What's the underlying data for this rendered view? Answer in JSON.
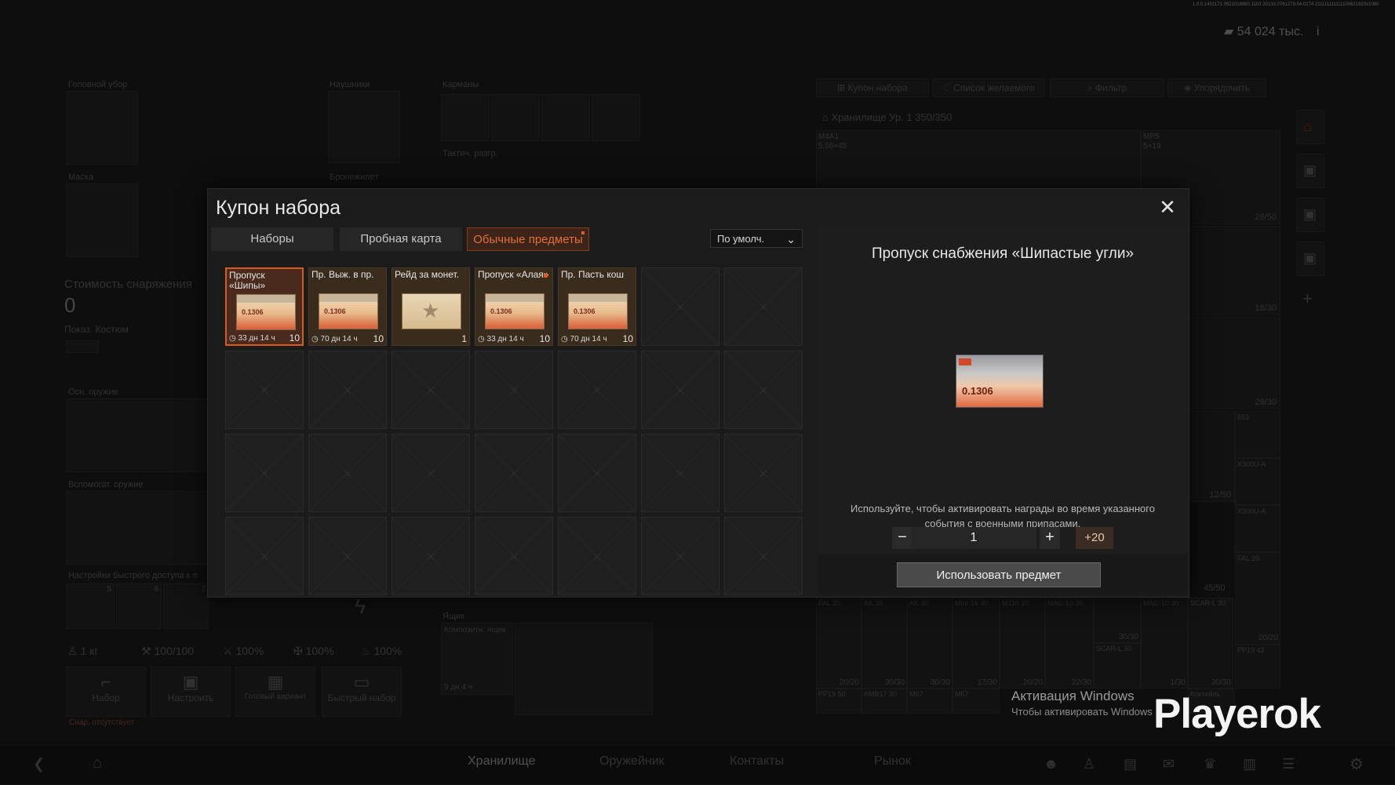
{
  "version_string": "1.0.0.1401171 0921018860.1103 20133.0761279.04.0274 211111111111100621920x1080",
  "currency": {
    "amount": "54 024 тыс.",
    "info": "i"
  },
  "background": {
    "labels": {
      "headgear": "Головной убор",
      "headphones": "Наушники",
      "pockets": "Карманы",
      "tactical_vest": "Тактич. разгр.",
      "mask": "Маска",
      "body_armor": "Бронежилет",
      "equipment_cost": "Стоимость снаряжения",
      "equipment_cost_value": "0",
      "show_costume": "Показ. Костюм",
      "primary_weapon": "Осн. оружие",
      "secondary_weapon": "Вспомогат. оружие",
      "quick_access": "Настройки быстрого доступа к п",
      "box": "Ящик",
      "composite_box": "Композитн. ящик",
      "box_timer": "9 дн 4 ч",
      "no_equipment": "Снар. отсутствует"
    },
    "stats": [
      "1 кг",
      "100/100",
      "100%",
      "100%",
      "100%"
    ],
    "quick_slots": [
      "5",
      "6",
      "7"
    ],
    "action_buttons": [
      "Набор",
      "Настроить",
      "Готовый вариант",
      "Быстрый набор"
    ],
    "right_panel": {
      "buttons": [
        "Купон набора",
        "Список желаемого",
        "Фильтр",
        "Упорядочить"
      ],
      "storage": "Хранилище Ур. 1 350/350",
      "weapons": [
        "M4A1",
        "5.56×45",
        "MP5",
        "5×19"
      ],
      "counts": [
        "26/50",
        "18/30",
        "29/30",
        "12/50",
        "45/50",
        "20/20",
        "30/30",
        "30/30",
        "17/30",
        "20/20",
        "22/30",
        "30/30",
        "1/30",
        "30/30",
        "20/20"
      ],
      "scopes": [
        "553",
        "X300U-A",
        "X300U-A",
        "FAL 20"
      ],
      "mags": [
        "FAL 20",
        "AK 30",
        "AK 30",
        "Mini-14 30",
        "M110 20",
        "MAC-10 30",
        "MAC-10 30",
        "SCAR-L 30",
        "SCAR-L 30",
        "PP19 42",
        "PP19 50",
        "AMB17 30",
        "M67",
        "M67",
        "Коктейль"
      ]
    }
  },
  "bottom_nav": {
    "tabs": [
      "Хранилище",
      "Оружейник",
      "Контакты",
      "Рынок"
    ],
    "active": 0
  },
  "modal": {
    "title": "Купон набора",
    "tabs": [
      "Наборы",
      "Пробная карта",
      "Обычные предметы"
    ],
    "active_tab": 2,
    "sort": "По умолч.",
    "items": [
      {
        "name": "Пропуск «Шипы»",
        "time": "33 дн 14 ч",
        "count": "10",
        "kind": "ticket",
        "selected": true,
        "dot": false
      },
      {
        "name": "Пр. Выж. в пр.",
        "time": "70 дн 14 ч",
        "count": "10",
        "kind": "ticket",
        "selected": false,
        "dot": false
      },
      {
        "name": "Рейд за монет.",
        "time": "",
        "count": "1",
        "kind": "star",
        "selected": false,
        "dot": false
      },
      {
        "name": "Пропуск «Алая»",
        "time": "33 дн 14 ч",
        "count": "10",
        "kind": "ticket",
        "selected": false,
        "dot": true
      },
      {
        "name": "Пр. Пасть кош",
        "time": "70 дн 14 ч",
        "count": "10",
        "kind": "ticket",
        "selected": false,
        "dot": false
      }
    ],
    "ticket_code": "0.1306",
    "grid": {
      "cols": 7,
      "rows": 4
    },
    "detail": {
      "title": "Пропуск снабжения «Шипастые угли»",
      "code": "0.1306",
      "description": "Используйте, чтобы активировать награды во время указанного события с военными припасами.",
      "quantity": "1",
      "minus": "−",
      "plus": "+",
      "max": "+20",
      "use_button": "Использовать предмет"
    },
    "close": "✕"
  },
  "windows_activation": {
    "title": "Активация Windows",
    "subtitle": "Чтобы активировать Windows"
  },
  "watermark": "Playerok"
}
